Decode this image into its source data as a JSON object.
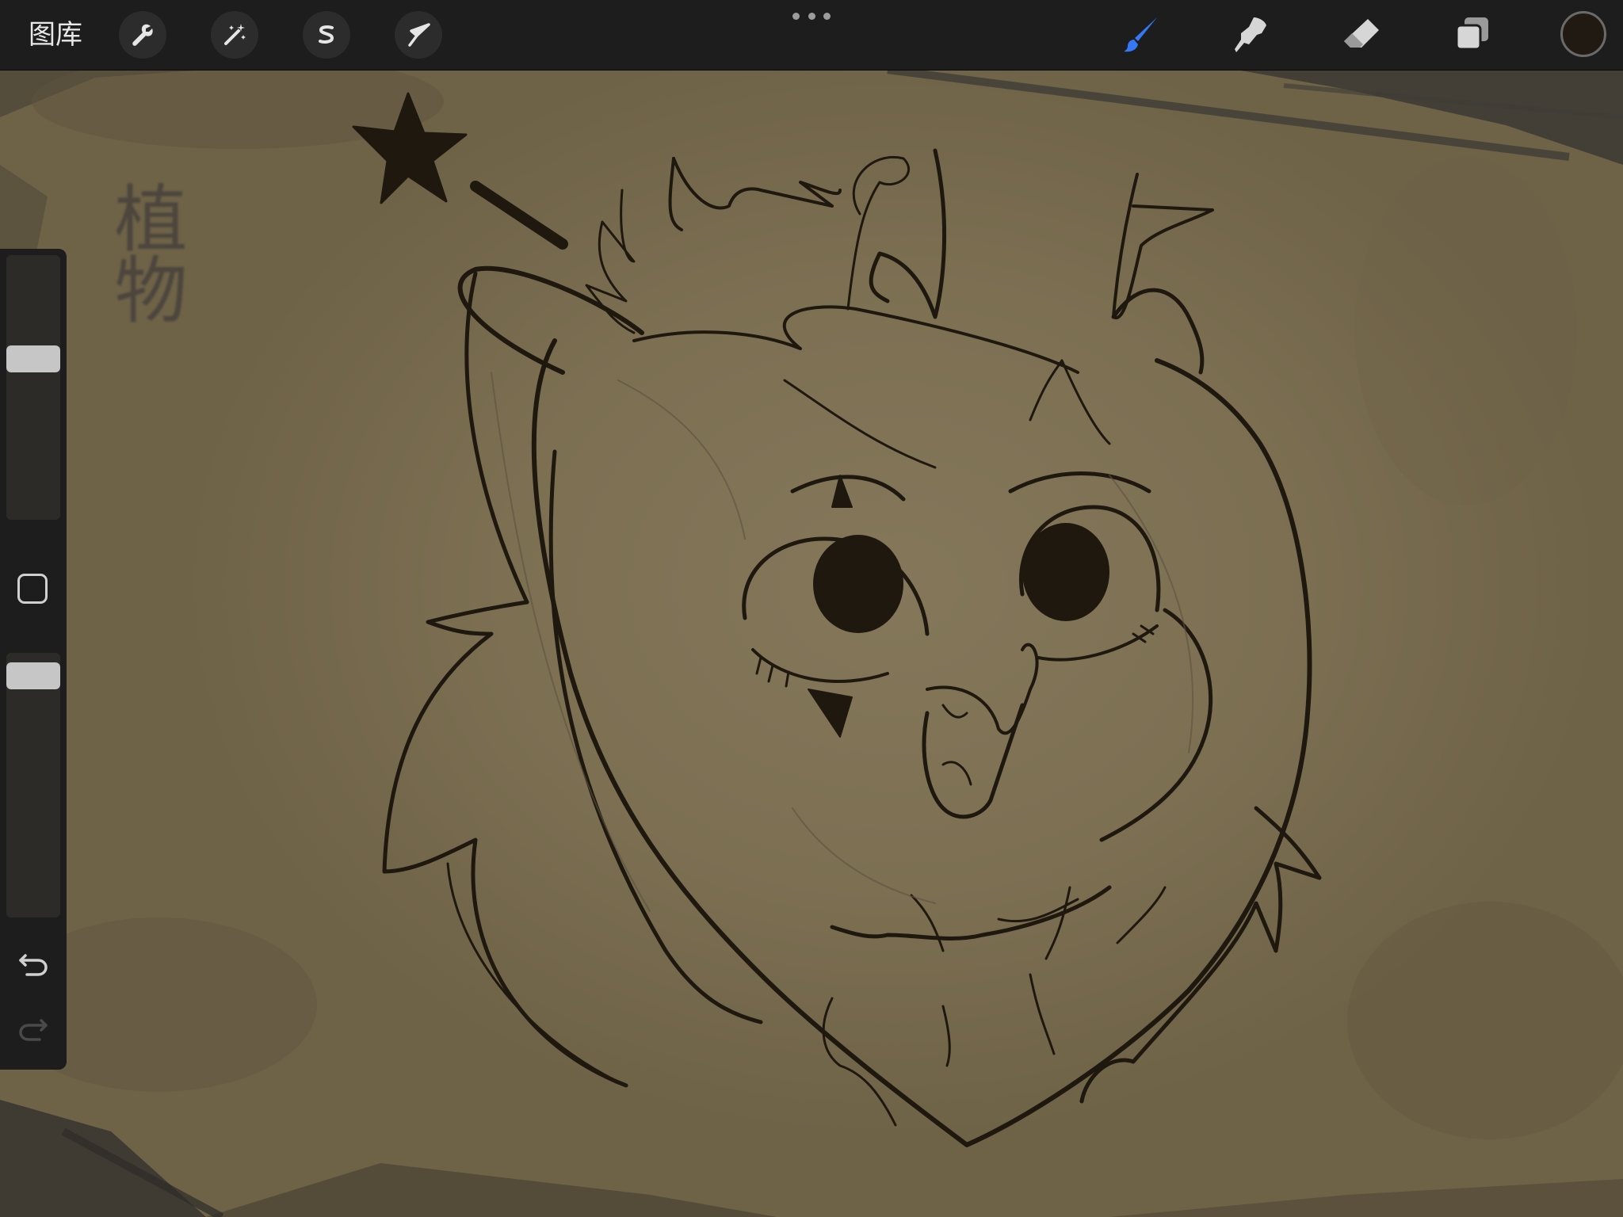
{
  "app": {
    "gallery_label": "图库"
  },
  "toolbar": {
    "left_tools": [
      "wrench-icon",
      "magic-wand-icon",
      "selection-s-icon",
      "transform-arrow-icon"
    ],
    "right_tools": [
      "brush-icon",
      "smudge-icon",
      "eraser-icon",
      "layers-icon"
    ],
    "active_tool": "brush",
    "active_color": "#211a12",
    "accent_color": "#3478f6"
  },
  "sidebar": {
    "brush_size_level": 0.62,
    "opacity_level": 0.96,
    "icons": [
      "modify-square-icon",
      "undo-icon",
      "redo-icon"
    ]
  },
  "canvas": {
    "stamp_text": "植物",
    "paper_color": "#7f7256",
    "ink_color": "#1e180f"
  }
}
